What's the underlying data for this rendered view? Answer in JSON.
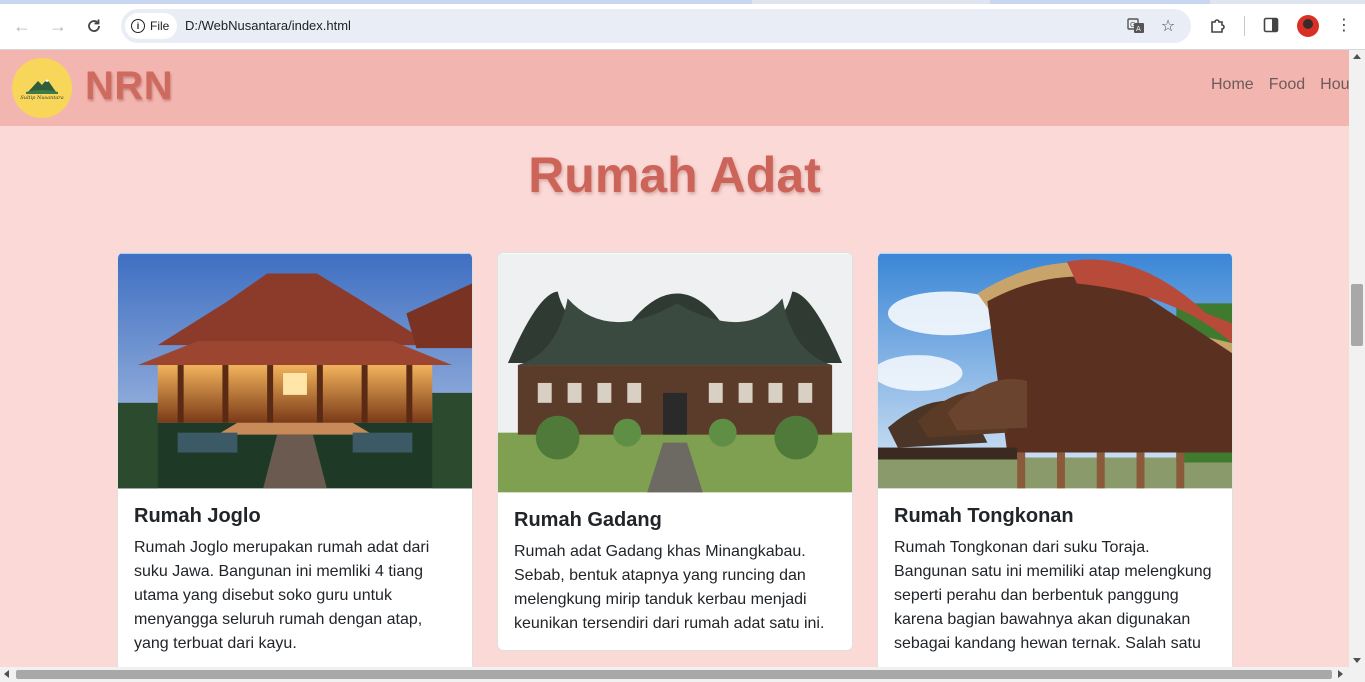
{
  "browser": {
    "file_label": "File",
    "url": "D:/WebNusantara/index.html"
  },
  "site": {
    "brand": "NRN",
    "logo_text": "Sultip Nusantara",
    "nav": [
      "Home",
      "Food",
      "Hou"
    ]
  },
  "section": {
    "title": "Rumah Adat"
  },
  "cards": [
    {
      "title": "Rumah Joglo",
      "text": "Rumah Joglo merupakan rumah adat dari suku Jawa. Bangunan ini memliki 4 tiang utama yang disebut soko guru untuk menyangga seluruh rumah dengan atap, yang terbuat dari kayu."
    },
    {
      "title": "Rumah Gadang",
      "text": "Rumah adat Gadang khas Minangkabau. Sebab, bentuk atapnya yang runcing dan melengkung mirip tanduk kerbau menjadi keunikan tersendiri dari rumah adat satu ini."
    },
    {
      "title": "Rumah Tongkonan",
      "text": "Rumah Tongkonan dari suku Toraja. Bangunan satu ini memiliki atap melengkung seperti perahu dan berbentuk panggung karena bagian bawahnya akan digunakan sebagai kandang hewan ternak. Salah satu"
    }
  ]
}
